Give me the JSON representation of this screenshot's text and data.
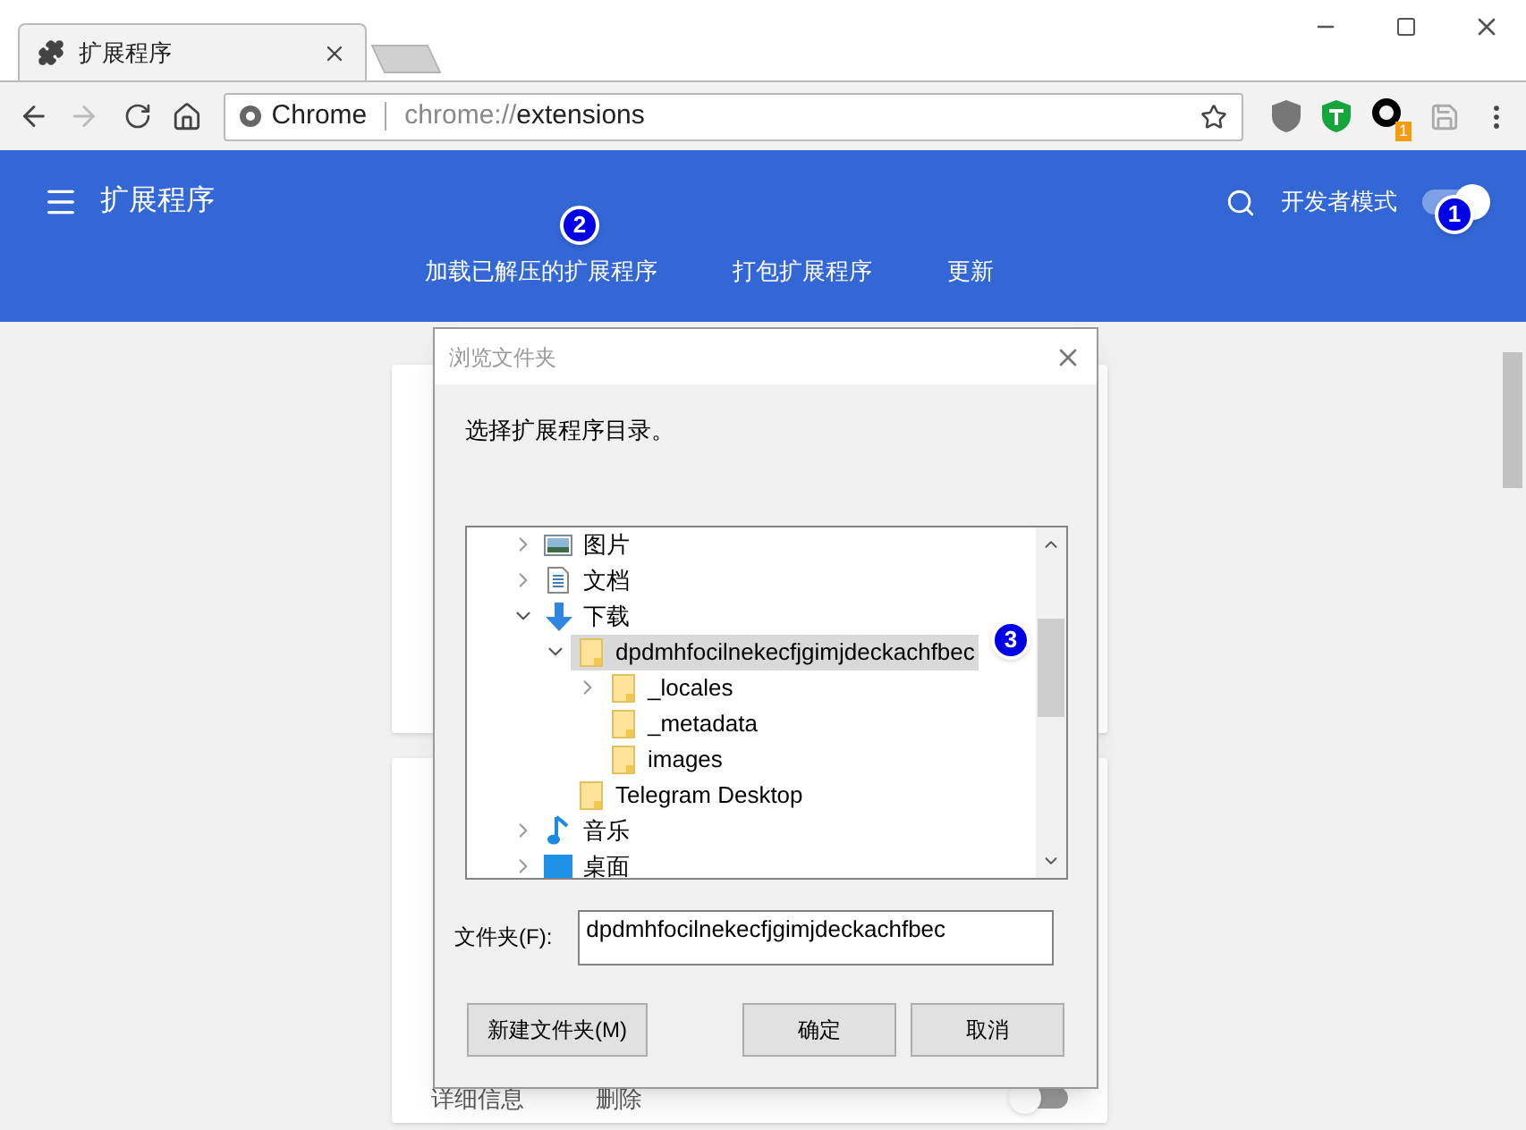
{
  "tab": {
    "title": "扩展程序"
  },
  "omnibox": {
    "site_label": "Chrome",
    "url_scheme": "chrome://",
    "url_path": "extensions"
  },
  "extension_badge": "1",
  "header": {
    "title": "扩展程序",
    "dev_mode_label": "开发者模式",
    "dev_mode_on": true,
    "actions": [
      "加载已解压的扩展程序",
      "打包扩展程序",
      "更新"
    ]
  },
  "callouts": [
    "1",
    "2",
    "3"
  ],
  "card_footer": {
    "details": "详细信息",
    "remove": "删除",
    "enabled": false
  },
  "dialog": {
    "title": "浏览文件夹",
    "instruction": "选择扩展程序目录。",
    "tree": [
      {
        "label": "图片",
        "kind": "pictures",
        "expanded": false
      },
      {
        "label": "文档",
        "kind": "documents",
        "expanded": false
      },
      {
        "label": "下载",
        "kind": "downloads",
        "expanded": true,
        "children": [
          {
            "label": "dpdmhfocilnekecfjgimjdeckachfbec",
            "kind": "folder",
            "expanded": true,
            "selected": true,
            "children": [
              {
                "label": "_locales",
                "kind": "folder",
                "expanded": false,
                "selected": false
              },
              {
                "label": "_metadata",
                "kind": "folder",
                "selected": false
              },
              {
                "label": "images",
                "kind": "folder",
                "selected": false
              }
            ]
          },
          {
            "label": "Telegram Desktop",
            "kind": "folder",
            "selected": false
          }
        ]
      },
      {
        "label": "音乐",
        "kind": "music",
        "expanded": false
      },
      {
        "label": "桌面",
        "kind": "desktop",
        "expanded": false
      }
    ],
    "folder_label": "文件夹(F):",
    "folder_value": "dpdmhfocilnekecfjgimjdeckachfbec",
    "buttons": [
      "新建文件夹(M)",
      "确定",
      "取消"
    ]
  }
}
